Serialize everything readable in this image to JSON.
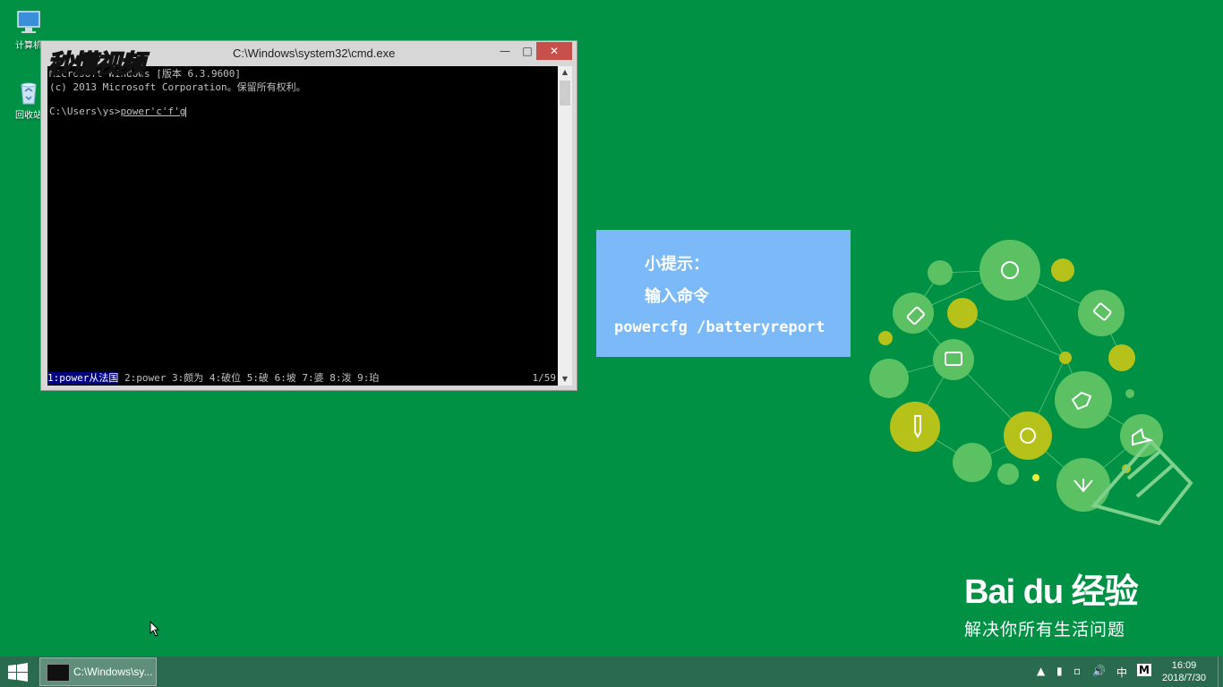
{
  "desktop": {
    "icons": [
      {
        "label": "计算机",
        "icon": "computer-icon"
      },
      {
        "label": "回收站",
        "icon": "recycle-bin-icon"
      }
    ]
  },
  "cmd": {
    "title": "C:\\Windows\\system32\\cmd.exe",
    "lines": [
      "Microsoft Windows [版本 6.3.9600]",
      "(c) 2013 Microsoft Corporation。保留所有权利。",
      "",
      "C:\\Users\\ys>"
    ],
    "typed": "power'c'f'g",
    "ime_candidates_selected": "1:power从法国",
    "ime_candidates_rest": " 2:power 3:颇为 4:破位 5:破 6:坡 7:婆 8:泼 9:珀",
    "ime_page": "1/59"
  },
  "watermark": {
    "text": "秒懂视频"
  },
  "tip": {
    "title": "小提示：",
    "line1": "输入命令",
    "command": "powercfg /batteryreport"
  },
  "brand": {
    "logo_text": "Bai du 经验",
    "slogan": "解决你所有生活问题"
  },
  "taskbar": {
    "start_icon": "windows-logo-icon",
    "task_label": "C:\\Windows\\sy...",
    "tray_ime": "中",
    "tray_m": "M",
    "time": "16:09",
    "date": "2018/7/30"
  },
  "colors": {
    "desktop_bg": "#009145",
    "tip_bg": "#7bb9f9",
    "taskbar_bg": "#2a6a4f",
    "close_btn": "#c7504b"
  }
}
